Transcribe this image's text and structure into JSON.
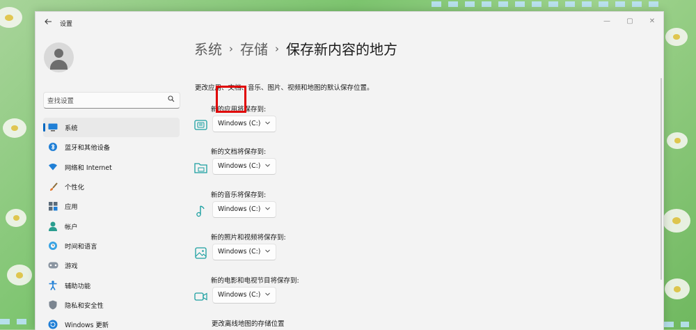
{
  "window": {
    "title": "设置",
    "controls": {
      "minimize": "—",
      "maximize": "▢",
      "close": "✕"
    }
  },
  "sidebar": {
    "search_placeholder": "查找设置",
    "items": [
      {
        "label": "系统",
        "icon": "monitor-icon",
        "active": true
      },
      {
        "label": "蓝牙和其他设备",
        "icon": "bluetooth-icon"
      },
      {
        "label": "网络和 Internet",
        "icon": "wifi-icon"
      },
      {
        "label": "个性化",
        "icon": "paintbrush-icon"
      },
      {
        "label": "应用",
        "icon": "apps-icon"
      },
      {
        "label": "帐户",
        "icon": "person-icon"
      },
      {
        "label": "时间和语言",
        "icon": "globe-clock-icon"
      },
      {
        "label": "游戏",
        "icon": "gamepad-icon"
      },
      {
        "label": "辅助功能",
        "icon": "accessibility-icon"
      },
      {
        "label": "隐私和安全性",
        "icon": "shield-icon"
      },
      {
        "label": "Windows 更新",
        "icon": "update-icon"
      }
    ]
  },
  "breadcrumb": {
    "level1": "系统",
    "level2": "存储",
    "current": "保存新内容的地方",
    "separator": "›"
  },
  "description": "更改应用、文档、音乐、图片、视频和地图的默认保存位置。",
  "settings": [
    {
      "label": "新的应用将保存到:",
      "value": "Windows (C:)",
      "icon": "app-storage-icon"
    },
    {
      "label": "新的文档将保存到:",
      "value": "Windows (C:)",
      "icon": "folder-icon"
    },
    {
      "label": "新的音乐将保存到:",
      "value": "Windows (C:)",
      "icon": "music-note-icon"
    },
    {
      "label": "新的照片和视频将保存到:",
      "value": "Windows (C:)",
      "icon": "picture-icon"
    },
    {
      "label": "新的电影和电视节目将保存到:",
      "value": "Windows (C:)",
      "icon": "video-camera-icon"
    }
  ],
  "maps_label": "更改离线地图的存储位置",
  "colors": {
    "accent": "#0067c0",
    "icon_teal": "#1a9fa0",
    "highlight": "#e00000"
  }
}
